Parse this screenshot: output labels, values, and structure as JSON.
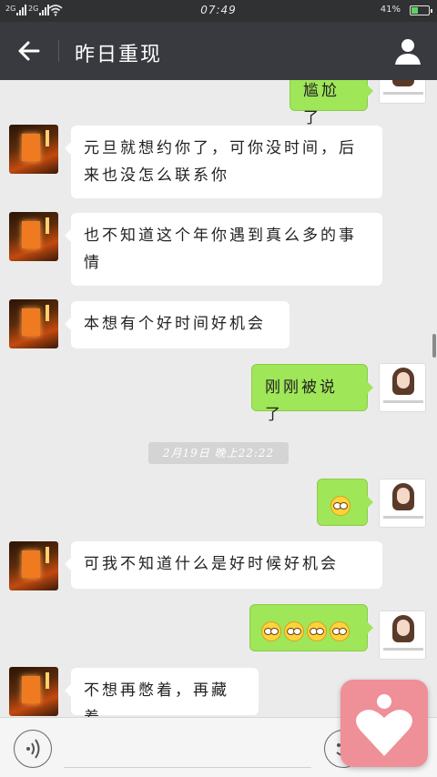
{
  "status_bar": {
    "signal1": "2G",
    "signal2": "2G",
    "time": "07:49",
    "battery_percent": "41%",
    "battery_level": 0.41
  },
  "header": {
    "title": "昨日重现"
  },
  "timestamp": "2月19日 晚上22:22",
  "messages": [
    {
      "side": "out",
      "text": "尴尬了"
    },
    {
      "side": "in",
      "text": "元旦就想约你了，可你没时间，后来也没怎么联系你"
    },
    {
      "side": "in",
      "text": "也不知道这个年你遇到真么多的事情"
    },
    {
      "side": "in",
      "text": "本想有个好时间好机会"
    },
    {
      "side": "out",
      "text": "刚刚被说了"
    },
    {
      "side": "out",
      "emoji_count": 1,
      "emoji": "awkward-smile-icon"
    },
    {
      "side": "in",
      "text": "可我不知道什么是好时候好机会"
    },
    {
      "side": "out",
      "emoji_count": 4,
      "emoji": "awkward-smile-icon"
    },
    {
      "side": "in",
      "text": "不想再憋着，再藏着"
    }
  ],
  "colors": {
    "header_bg": "#393a3f",
    "status_bg": "#2f3133",
    "chat_bg": "#ebebeb",
    "outgoing_bubble": "#9fe658",
    "incoming_bubble": "#ffffff",
    "widget_bg": "#ef8f97"
  },
  "icons": {
    "back": "back-arrow-icon",
    "profile": "person-icon",
    "voice": "voice-icon",
    "emoji": "smiley-icon",
    "widget": "heart-person-icon"
  }
}
